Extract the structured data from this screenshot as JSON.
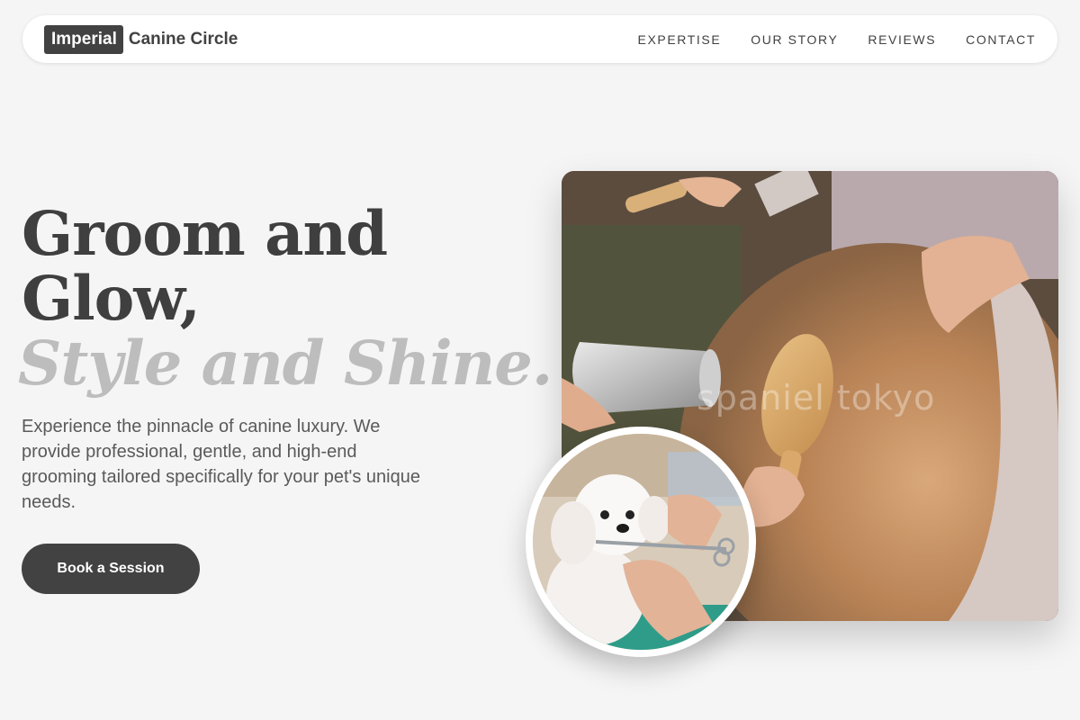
{
  "brand": {
    "highlight": "Imperial",
    "rest": "Canine Circle"
  },
  "nav": {
    "links": [
      {
        "label": "EXPERTISE"
      },
      {
        "label": "OUR STORY"
      },
      {
        "label": "REVIEWS"
      },
      {
        "label": "CONTACT"
      }
    ]
  },
  "hero": {
    "title_line1": "Groom and",
    "title_line2": "Glow,",
    "title_accent": "Style and Shine.",
    "description": "Experience the pinnacle of canine luxury. We provide professional, gentle, and high-end grooming tailored specifically for your pet's unique needs.",
    "cta_label": "Book a Session"
  },
  "images": {
    "main_watermark": "spaniel tokyo"
  },
  "colors": {
    "background": "#f5f5f5",
    "primary": "#424242",
    "accent_text": "#bdbdbd",
    "nav_bg": "#ffffff"
  }
}
